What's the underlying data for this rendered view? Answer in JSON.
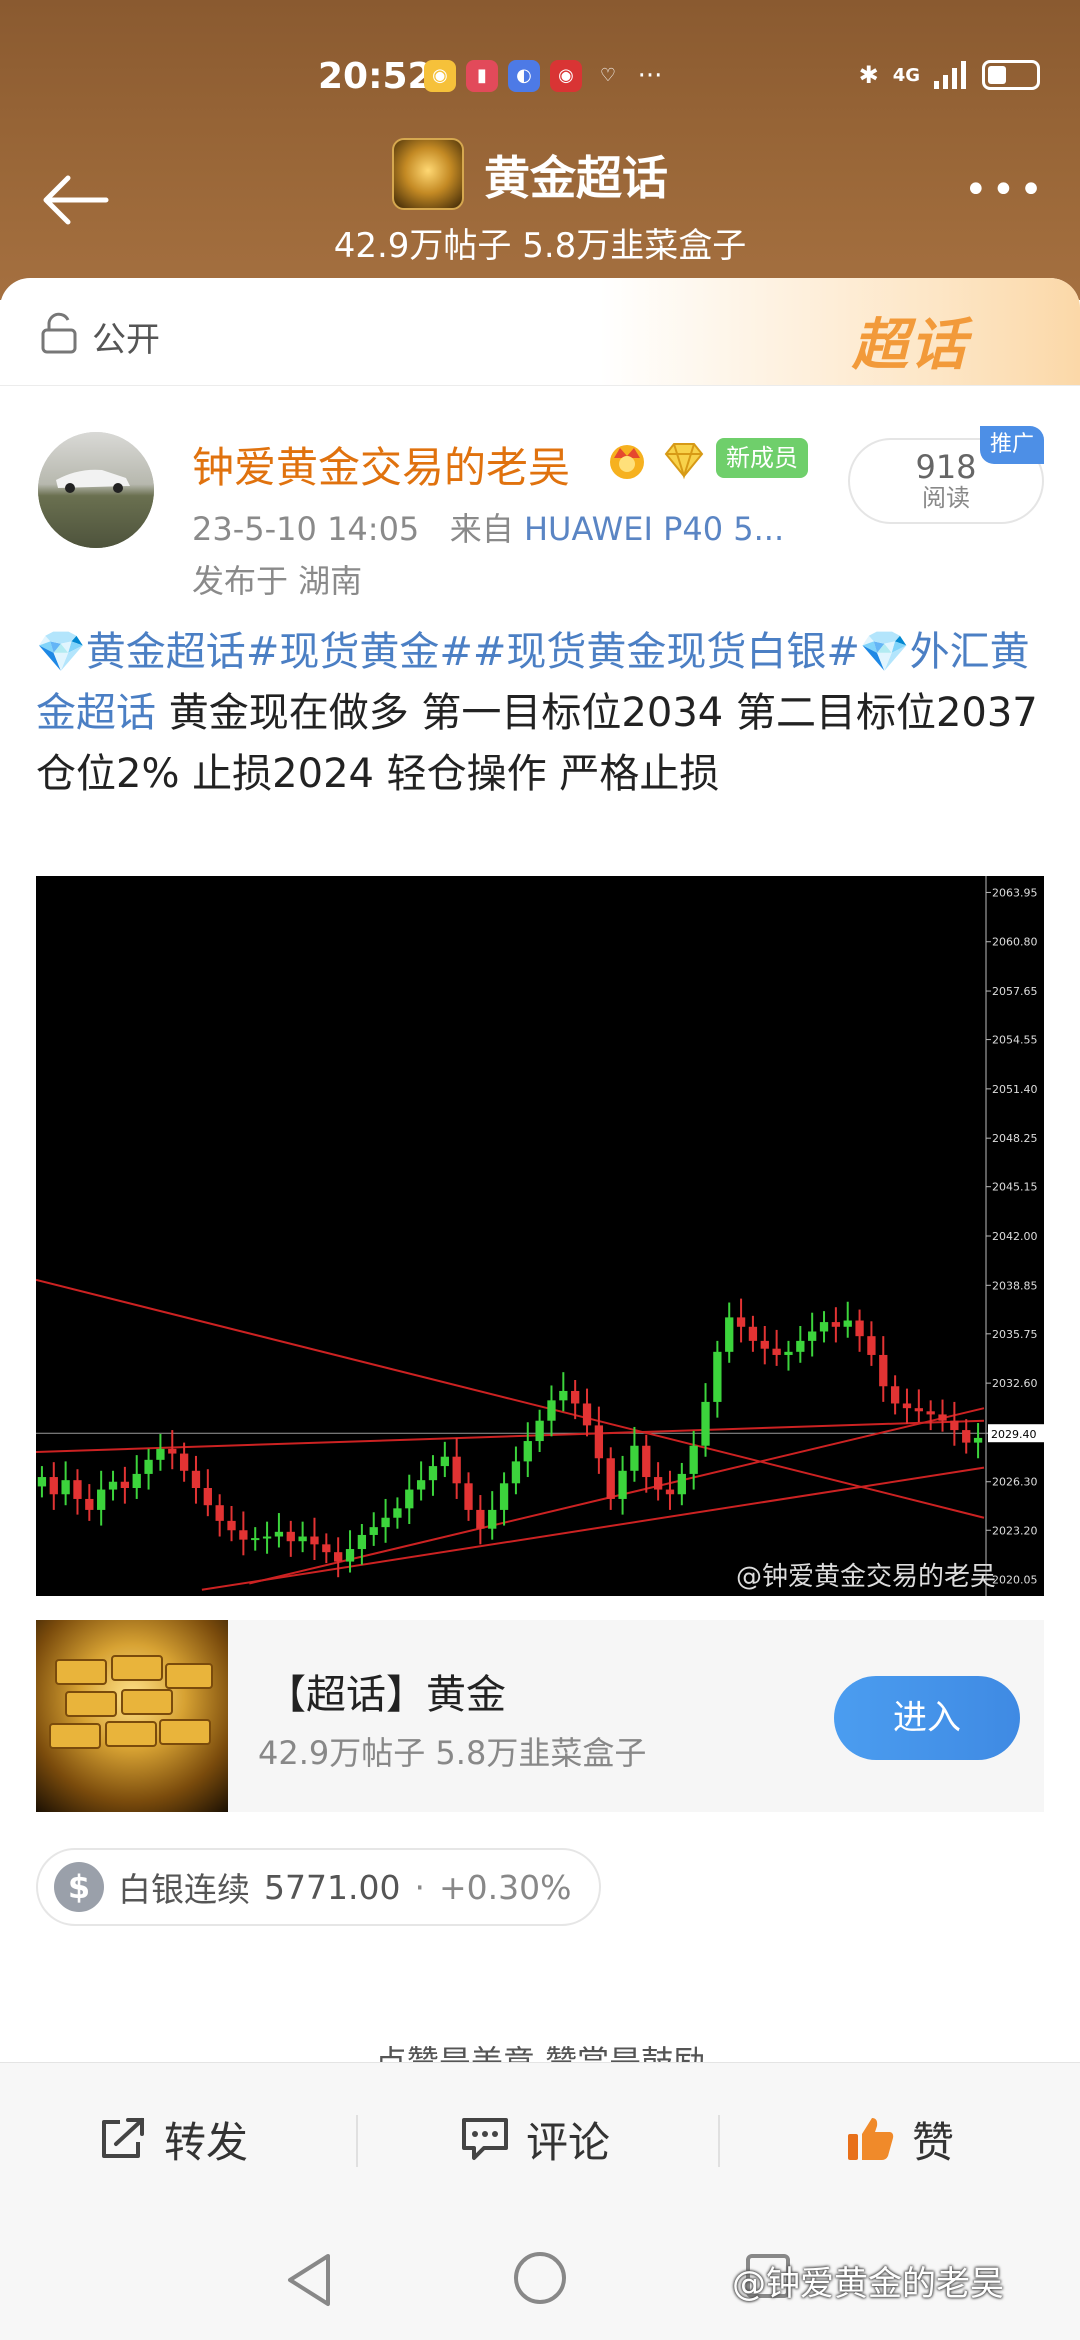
{
  "status_bar": {
    "time": "20:52",
    "network": "4G",
    "app_icons": [
      "weibo-icon",
      "book-icon",
      "browser-icon",
      "weibo-red-icon",
      "heart-icon"
    ],
    "more": "···"
  },
  "header": {
    "title": "黄金超话",
    "subtitle": "42.9万帖子 5.8万韭菜盒子",
    "more": "•••"
  },
  "visibility": {
    "label": "公开",
    "logo_text": "超话"
  },
  "post": {
    "author": "钟爱黄金交易的老吴",
    "new_member_badge": "新成员",
    "time": "23-5-10 14:05",
    "source_prefix": "来自",
    "device": "HUAWEI P40 5...",
    "location": "发布于 湖南",
    "read_count": "918",
    "read_label": "阅读",
    "promo_tag": "推广",
    "tags": [
      "💎黄金超话",
      "#现货黄金#",
      "#现货黄金现货白银#",
      "💎外汇黄金超话"
    ],
    "body": " 黄金现在做多  第一目标位2034    第二目标位2037      仓位2%  止损2024    轻仓操作   严格止损"
  },
  "chart_data": {
    "type": "candlestick",
    "y_axis_ticks": [
      "2063.95",
      "2060.80",
      "2057.65",
      "2054.55",
      "2051.40",
      "2048.25",
      "2045.15",
      "2042.00",
      "2038.85",
      "2035.75",
      "2032.60",
      "2029.40",
      "2026.30",
      "2023.20",
      "2020.05"
    ],
    "current_price_label": "2029.40",
    "close_series": [
      2026.6,
      2025.5,
      2026.4,
      2025.2,
      2024.5,
      2025.8,
      2026.3,
      2025.9,
      2026.8,
      2027.7,
      2028.4,
      2028.1,
      2027.0,
      2025.9,
      2024.8,
      2023.8,
      2023.2,
      2022.6,
      2022.7,
      2022.8,
      2023.1,
      2022.5,
      2022.8,
      2022.3,
      2021.8,
      2021.2,
      2022.0,
      2022.9,
      2023.4,
      2024.0,
      2024.6,
      2025.8,
      2026.4,
      2027.3,
      2027.9,
      2026.2,
      2024.5,
      2023.3,
      2024.5,
      2026.2,
      2027.6,
      2028.9,
      2030.2,
      2031.5,
      2032.1,
      2031.3,
      2029.9,
      2027.8,
      2025.2,
      2027.0,
      2028.6,
      2026.6,
      2025.8,
      2025.5,
      2026.8,
      2028.6,
      2031.4,
      2034.6,
      2036.8,
      2036.2,
      2035.3,
      2034.8,
      2034.4,
      2034.6,
      2035.3,
      2035.9,
      2036.5,
      2036.2,
      2036.6,
      2035.6,
      2034.4,
      2032.4,
      2031.3,
      2031.0,
      2030.8,
      2030.6,
      2030.2,
      2029.6,
      2028.8,
      2029.1
    ],
    "trend_lines": [
      {
        "from": [
          0,
          2039.2
        ],
        "to": [
          80,
          2024.0
        ]
      },
      {
        "from": [
          0,
          2028.2
        ],
        "to": [
          80,
          2030.2
        ]
      },
      {
        "from": [
          14,
          2019.4
        ],
        "to": [
          80,
          2027.2
        ]
      },
      {
        "from": [
          18,
          2019.8
        ],
        "to": [
          80,
          2031.0
        ]
      }
    ],
    "horizontal_line": 2029.4,
    "ylim": [
      2019.0,
      2065.0
    ],
    "watermark": "@钟爱黄金交易的老吴"
  },
  "topic_card": {
    "title": "【超话】黄金",
    "subtitle": "42.9万帖子 5.8万韭菜盒子",
    "enter_label": "进入"
  },
  "stock": {
    "symbol_icon": "$",
    "name": "白银连续",
    "price": "5771.00",
    "dot": "·",
    "change": "+0.30%"
  },
  "cut_text": "点赞是美意  赞赏是鼓励",
  "actions": {
    "repost": "转发",
    "comment": "评论",
    "like": "赞"
  },
  "watermark": "@钟爱黄金的老吴",
  "colors": {
    "author": "#e0720e",
    "tag": "#4b7fc4",
    "up_candle": "#3cd43c",
    "down_candle": "#e23333",
    "trend_line": "#cc2222",
    "enter_button": "#4296ea"
  }
}
